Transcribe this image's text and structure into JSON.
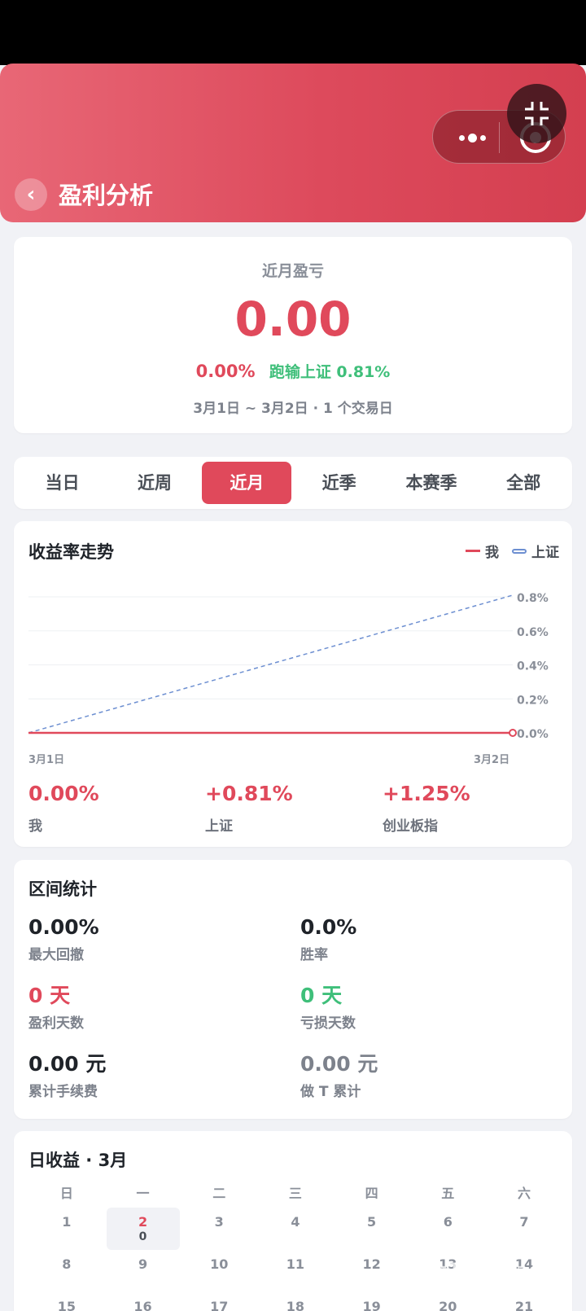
{
  "header": {
    "title": "盈利分析",
    "back_icon": "‹"
  },
  "summary": {
    "label": "近月盈亏",
    "value": "0.00",
    "pct": "0.00%",
    "compare": "跑输上证 0.81%",
    "range": "3月1日 ~ 3月2日 · 1 个交易日"
  },
  "tabs": [
    "当日",
    "近周",
    "近月",
    "近季",
    "本赛季",
    "全部"
  ],
  "trend": {
    "title": "收益率走势",
    "legend_me": "我",
    "legend_sh": "上证",
    "stats": [
      {
        "value": "0.00%",
        "label": "我"
      },
      {
        "value": "+0.81%",
        "label": "上证"
      },
      {
        "value": "+1.25%",
        "label": "创业板指"
      }
    ]
  },
  "chart_data": {
    "type": "line",
    "x": [
      "3月1日",
      "3月2日"
    ],
    "series": [
      {
        "name": "我",
        "values": [
          0.0,
          0.0
        ],
        "color": "#e0495b",
        "style": "solid"
      },
      {
        "name": "上证",
        "values": [
          0.0,
          0.81
        ],
        "color": "#6d8fd1",
        "style": "dashed"
      }
    ],
    "y_ticks": [
      "0.8%",
      "0.6%",
      "0.4%",
      "0.2%",
      "0.0%"
    ],
    "ylim": [
      0,
      0.8
    ],
    "grid": true,
    "legend": "top-right"
  },
  "stats": {
    "title": "区间统计",
    "items": [
      {
        "value": "0.00%",
        "label": "最大回撤",
        "color": "#1f2329"
      },
      {
        "value": "0.0%",
        "label": "胜率",
        "color": "#1f2329"
      },
      {
        "value": "0 天",
        "label": "盈利天数",
        "color": "#e0495b"
      },
      {
        "value": "0 天",
        "label": "亏损天数",
        "color": "#3fbf7a"
      },
      {
        "value": "0.00 元",
        "label": "累计手续费",
        "color": "#1f2329"
      },
      {
        "value": "0.00 元",
        "label": "做 T 累计",
        "color": "#7d828c"
      }
    ]
  },
  "calendar": {
    "title": "日收益 · 3月",
    "weekdays": [
      "日",
      "一",
      "二",
      "三",
      "四",
      "五",
      "六"
    ],
    "rows": [
      [
        "1",
        "2",
        "3",
        "4",
        "5",
        "6",
        "7"
      ],
      [
        "8",
        "9",
        "10",
        "11",
        "12",
        "13",
        "14"
      ],
      [
        "15",
        "16",
        "17",
        "18",
        "19",
        "20",
        "21"
      ]
    ],
    "selected_day": "2",
    "selected_sub": "0"
  },
  "watermark": "TapTap Glad",
  "colors": {
    "accent": "#e0495b",
    "gain": "#e0495b",
    "loss": "#3fbf7a",
    "index_line": "#6d8fd1"
  }
}
